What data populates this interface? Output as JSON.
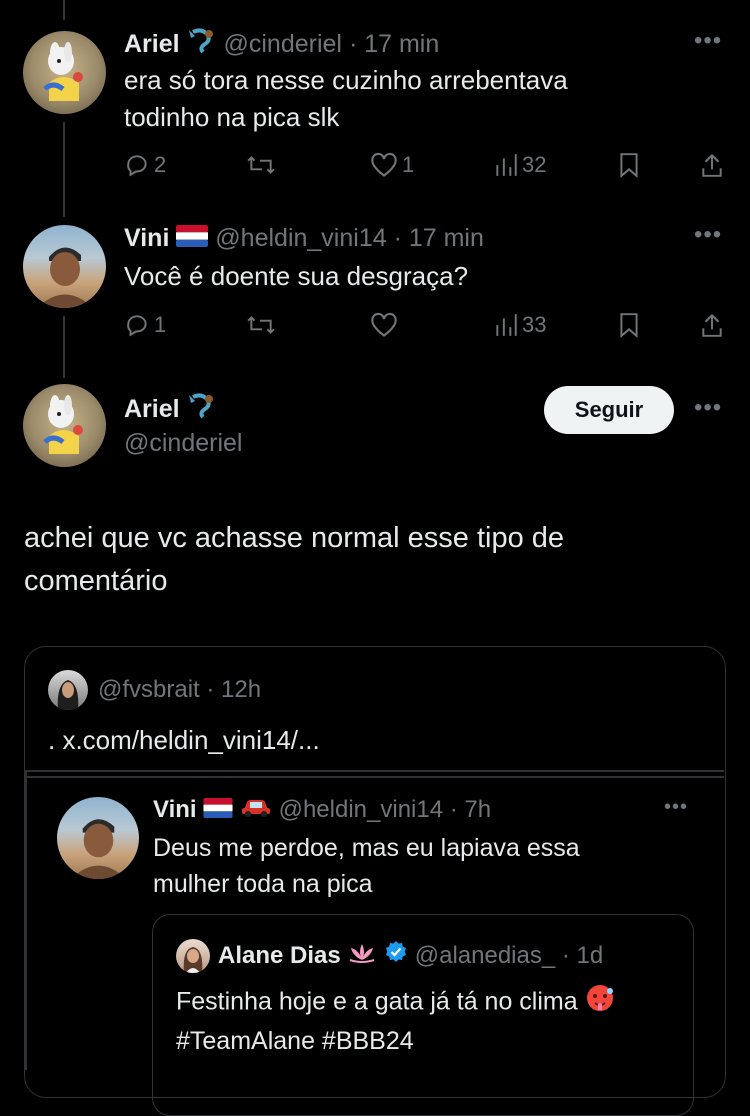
{
  "reply1": {
    "name": "Ariel",
    "handle": "@cinderiel",
    "time": "· 17 min",
    "text_line1": "era só tora nesse cuzinho arrebentava",
    "text_line2": "todinho na pica slk",
    "replies": "2",
    "likes": "1",
    "views": "32",
    "badge_icon": "mermaid-icon"
  },
  "reply2": {
    "name": "Vini",
    "handle": "@heldin_vini14",
    "time": "· 17 min",
    "text": "Você é doente sua desgraça?",
    "replies": "1",
    "views": "33",
    "badge_icon": "netherlands-flag-icon"
  },
  "main_tweet": {
    "name": "Ariel",
    "handle": "@cinderiel",
    "follow_label": "Seguir",
    "text_line1": "achei que vc achasse normal esse tipo de",
    "text_line2": "comentário",
    "badge_icon": "mermaid-icon"
  },
  "quote": {
    "handle": "@fvsbrait",
    "time": "· 12h",
    "text": ". x.com/heldin_vini14/..."
  },
  "quoted_tweet": {
    "name": "Vini",
    "handle": "@heldin_vini14",
    "time": "· 7h",
    "text_line1": "Deus me perdoe, mas eu lapiava essa",
    "text_line2": "mulher toda na pica"
  },
  "nested_tweet": {
    "name": "Alane Dias",
    "handle": "@alanedias_",
    "time": "· 1d",
    "text_line1": "Festinha hoje e a gata já tá no clima",
    "text_line2": "#TeamAlane #BBB24",
    "badge_icon": "lotus-icon"
  },
  "colors": {
    "background": "#000000",
    "text": "#e7e9ea",
    "muted": "#71767b",
    "border": "#2f3336",
    "verified": "#1d9bf0"
  }
}
